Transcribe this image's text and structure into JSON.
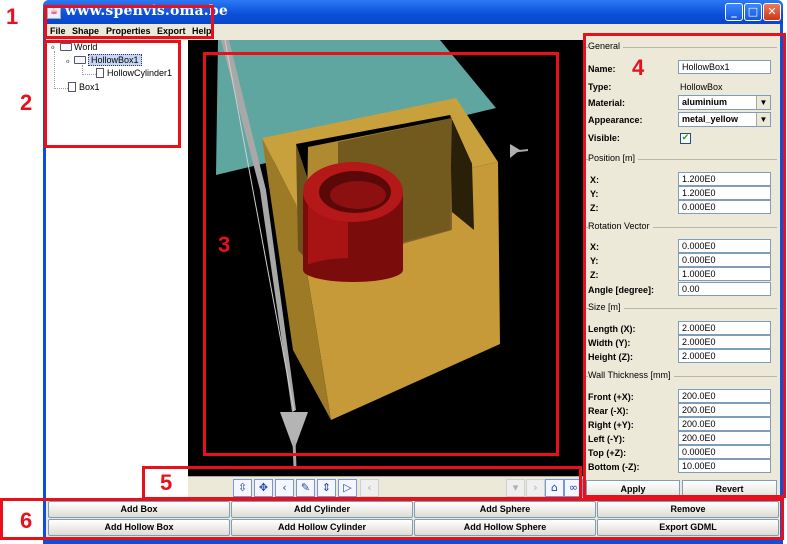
{
  "window": {
    "title": "www.spenvis.oma.be",
    "icon": "java-app-icon",
    "controls": [
      "minimize",
      "maximize",
      "close"
    ]
  },
  "menu": [
    "File",
    "Shape",
    "Properties",
    "Export",
    "Help"
  ],
  "tree": {
    "root": "World",
    "children": [
      {
        "label": "HollowBox1",
        "selected": true,
        "children": [
          {
            "label": "HollowCylinder1"
          }
        ]
      },
      {
        "label": "Box1"
      }
    ]
  },
  "properties": {
    "general": {
      "title": "General",
      "name_label": "Name:",
      "name_value": "HollowBox1",
      "type_label": "Type:",
      "type_value": "HollowBox",
      "material_label": "Material:",
      "material_value": "aluminium",
      "appearance_label": "Appearance:",
      "appearance_value": "metal_yellow",
      "visible_label": "Visible:",
      "visible_checked": true,
      "check_mark": "✔"
    },
    "position": {
      "title": "Position [m]",
      "x_label": "X:",
      "x": "1.200E0",
      "y_label": "Y:",
      "y": "1.200E0",
      "z_label": "Z:",
      "z": "0.000E0"
    },
    "rotation": {
      "title": "Rotation Vector",
      "x_label": "X:",
      "x": "0.000E0",
      "y_label": "Y:",
      "y": "0.000E0",
      "z_label": "Z:",
      "z": "1.000E0",
      "angle_label": "Angle [degree]:",
      "angle": "0.00"
    },
    "size": {
      "title": "Size [m]",
      "length_label": "Length (X):",
      "length": "2.000E0",
      "width_label": "Width (Y):",
      "width": "2.000E0",
      "height_label": "Height (Z):",
      "height": "2.000E0"
    },
    "wall": {
      "title": "Wall Thickness [mm]",
      "front_label": "Front (+X):",
      "front": "200.0E0",
      "rear_label": "Rear (-X):",
      "rear": "200.0E0",
      "right_label": "Right (+Y):",
      "right": "200.0E0",
      "left_label": "Left (-Y):",
      "left": "200.0E0",
      "top_label": "Top (+Z):",
      "top": "0.000E0",
      "bottom_label": "Bottom (-Z):",
      "bottom": "10.00E0"
    },
    "apply_label": "Apply",
    "revert_label": "Revert"
  },
  "viewer": {
    "colors": {
      "background": "#000000",
      "plane": "#5fa5a0",
      "box": "#c8a03c",
      "box_dark": "#9c7a26",
      "cylinder": "#a81414",
      "axis": "#a8a8a8"
    }
  },
  "navbar": {
    "icons": [
      "rotate-icon",
      "pan-icon",
      "back-icon",
      "walk-icon",
      "tilt-icon",
      "forward-icon",
      "prev-icon",
      "dropdown-icon",
      "next-icon",
      "home-icon",
      "binoculars-icon",
      "fit-icon",
      "straighten-icon"
    ]
  },
  "actions": [
    "Add Box",
    "Add Cylinder",
    "Add Sphere",
    "Remove",
    "Add Hollow Box",
    "Add Hollow Cylinder",
    "Add Hollow Sphere",
    "Export GDML"
  ],
  "annotations": {
    "color": "#e8101a",
    "labels": [
      "1",
      "2",
      "3",
      "4",
      "5",
      "6"
    ]
  }
}
